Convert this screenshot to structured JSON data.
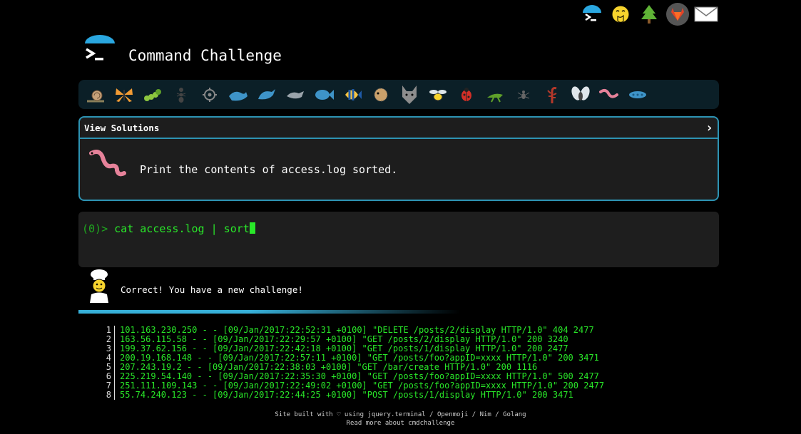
{
  "header": {
    "title": "Command Challenge",
    "top_icons": [
      "terminal-icon",
      "hand-over-mouth-face-icon",
      "tree-icon",
      "gitlab-icon",
      "mail-icon"
    ]
  },
  "animals": [
    "snail",
    "butterfly",
    "caterpillar",
    "ant",
    "microbe",
    "whale",
    "dolphin",
    "dolphin",
    "fish",
    "tropical-fish",
    "blowfish",
    "wolf",
    "bee",
    "ladybug",
    "cricket",
    "spider",
    "scorpion",
    "fly",
    "worm",
    "paramecium"
  ],
  "challenge": {
    "view_solutions_label": "View Solutions",
    "chevron": "›",
    "icon": "worm-icon",
    "task": "Print the contents of access.log sorted."
  },
  "terminal": {
    "prompt": "(0)>",
    "command": "cat access.log | sort"
  },
  "feedback": {
    "icon": "chef-icon",
    "message": "Correct! You have a new challenge!"
  },
  "progress": {
    "percent": 48
  },
  "output": [
    {
      "num": "1",
      "text": "101.163.230.250 - - [09/Jan/2017:22:52:31 +0100] \"DELETE /posts/2/display HTTP/1.0\" 404 2477"
    },
    {
      "num": "2",
      "text": "163.56.115.58 - - [09/Jan/2017:22:29:57 +0100] \"GET /posts/2/display HTTP/1.0\" 200 3240"
    },
    {
      "num": "3",
      "text": "199.37.62.156 - - [09/Jan/2017:22:42:18 +0100] \"GET /posts/1/display HTTP/1.0\" 200 2477"
    },
    {
      "num": "4",
      "text": "200.19.168.148 - - [09/Jan/2017:22:57:11 +0100] \"GET /posts/foo?appID=xxxx HTTP/1.0\" 200 3471"
    },
    {
      "num": "5",
      "text": "207.243.19.2 - - [09/Jan/2017:22:38:03 +0100] \"GET /bar/create HTTP/1.0\" 200 1116"
    },
    {
      "num": "6",
      "text": "225.219.54.140 - - [09/Jan/2017:22:35:30 +0100] \"GET /posts/foo?appID=xxxx HTTP/1.0\" 500 2477"
    },
    {
      "num": "7",
      "text": "251.111.109.143 - - [09/Jan/2017:22:49:02 +0100] \"GET /posts/foo?appID=xxxx HTTP/1.0\" 200 2477"
    },
    {
      "num": "8",
      "text": "55.74.240.123 - - [09/Jan/2017:22:44:25 +0100] \"POST /posts/1/display HTTP/1.0\" 200 3471"
    }
  ],
  "footer": {
    "line1": "Site built with ♡ using jquery.terminal / Openmoji / Nim / Golang",
    "line2": "Read more about cmdchallenge"
  }
}
